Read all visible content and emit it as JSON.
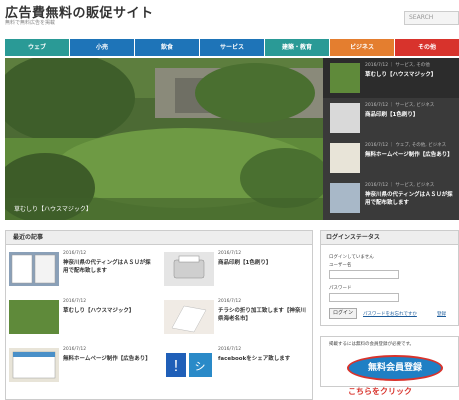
{
  "header": {
    "site_title": "広告費無料の販促サイト",
    "site_subtitle": "無料で無料広告を掲載",
    "search_placeholder": "SEARCH"
  },
  "nav": [
    {
      "label": "ウェブ",
      "color": "#2a9a96"
    },
    {
      "label": "小売",
      "color": "#1e74b8"
    },
    {
      "label": "飲食",
      "color": "#1e74b8"
    },
    {
      "label": "サービス",
      "color": "#1e74b8"
    },
    {
      "label": "建築・教育",
      "color": "#2a9a96"
    },
    {
      "label": "ビジネス",
      "color": "#e47e2f"
    },
    {
      "label": "その他",
      "color": "#d8332c"
    }
  ],
  "slider": {
    "caption": "草むしり【ハウスマジック】",
    "items": [
      {
        "meta": "2016/7/12 ｜ サービス, その他",
        "title": "草むしり【ハウスマジック】"
      },
      {
        "meta": "2016/7/12 ｜ サービス, ビジネス",
        "title": "商品印刷【1色刷り】"
      },
      {
        "meta": "2016/7/12 ｜ ウェブ, その他, ビジネス",
        "title": "無料ホームページ制作【広告あり】"
      },
      {
        "meta": "2016/7/12 ｜ サービス, ビジネス",
        "title": "神奈川県の代ティングはＡＳＵが採用で配布致します"
      }
    ]
  },
  "recent": {
    "heading": "最近の記事",
    "posts": [
      {
        "date": "2016/7/12",
        "title": "神奈川県の代ティングはＡＳＵが採用で配布致します"
      },
      {
        "date": "2016/7/12",
        "title": "商品印刷【1色刷り】"
      },
      {
        "date": "2016/7/12",
        "title": "草むしり【ハウスマジック】"
      },
      {
        "date": "2016/7/12",
        "title": "チラシの折り加工致します【神奈川県海老名市】"
      },
      {
        "date": "2016/7/12",
        "title": "無料ホームページ制作【広告あり】"
      },
      {
        "date": "2016/7/12",
        "title": "facebookをシェア致します"
      }
    ]
  },
  "login": {
    "heading": "ログインステータス",
    "status": "ログインしていません",
    "username_label": "ユーザー名",
    "password_label": "パスワード",
    "login_button": "ログイン",
    "forgot_link": "パスワードをお忘れですか",
    "register_link": "登録"
  },
  "promo": {
    "text": "掲載するには無料の会員登録が必要です。",
    "button_label": "無料会員登録",
    "click_text": "こちらをクリック"
  }
}
